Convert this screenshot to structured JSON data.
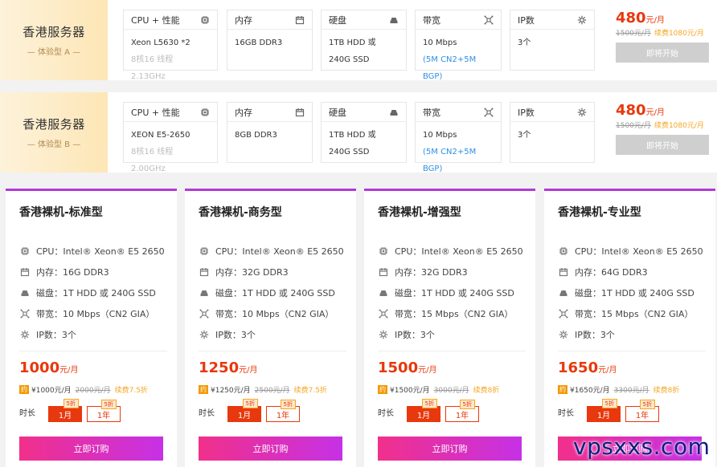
{
  "colors": {
    "price": "#e8380d",
    "accent_purple": "#b339d8",
    "renew": "#f5a623",
    "link_blue": "#2f8fe6",
    "disabled": "#cfcfcf"
  },
  "labels": {
    "cpu": "CPU + 性能",
    "mem": "内存",
    "disk": "硬盘",
    "bw": "带宽",
    "ip": "IP数"
  },
  "icons": {
    "cpu": "cpu-icon",
    "mem": "memory-icon",
    "disk": "disk-icon",
    "bw": "network-icon",
    "ip": "gear-icon"
  },
  "rows": [
    {
      "title": "香港服务器",
      "subtitle": "— 体验型 A —",
      "cpu": "Xeon L5630 *2",
      "cpu_sub": "8核16 线程 2.13GHz",
      "mem": "16GB DDR3",
      "disk1": "1TB HDD 或",
      "disk2": "240G SSD",
      "bw1": "10 Mbps",
      "bw2": "(5M CN2+5M BGP)",
      "ip": "3个",
      "price": "480",
      "unit": "元/月",
      "orig": "1500元/月",
      "renew": "续费1080元/月",
      "btn": "即将开始"
    },
    {
      "title": "香港服务器",
      "subtitle": "— 体验型 B —",
      "cpu": "XEON E5-2650",
      "cpu_sub": "8核16 线程 2.00GHz",
      "mem": "8GB DDR3",
      "disk1": "1TB HDD 或",
      "disk2": "240G SSD",
      "bw1": "10 Mbps",
      "bw2": "(5M CN2+5M BGP)",
      "ip": "3个",
      "price": "480",
      "unit": "元/月",
      "orig": "1500元/月",
      "renew": "续费1080元/月",
      "btn": "即将开始"
    }
  ],
  "cards": [
    {
      "title": "香港裸机-标准型",
      "cpu": "CPU：Intel® Xeon® E5 2650",
      "mem": "内存：16G DDR3",
      "disk": "磁盘：1T HDD 或 240G SSD",
      "bw": "带宽：10 Mbps（CN2 GIA）",
      "ip": "IP数：3个",
      "price": "1000",
      "unit": "元/月",
      "pay": "¥1000元/月",
      "orig": "2000元/月",
      "renew": "续费7.5折",
      "opt1": "1月",
      "opt1_disc": "5折",
      "opt2": "1年",
      "opt2_disc": "5折",
      "btn": "立即订购"
    },
    {
      "title": "香港裸机-商务型",
      "cpu": "CPU：Intel® Xeon® E5 2650",
      "mem": "内存：32G DDR3",
      "disk": "磁盘：1T HDD 或 240G SSD",
      "bw": "带宽：10 Mbps（CN2 GIA）",
      "ip": "IP数：3个",
      "price": "1250",
      "unit": "元/月",
      "pay": "¥1250元/月",
      "orig": "2500元/月",
      "renew": "续费7.5折",
      "opt1": "1月",
      "opt1_disc": "5折",
      "opt2": "1年",
      "opt2_disc": "5折",
      "btn": "立即订购"
    },
    {
      "title": "香港裸机-增强型",
      "cpu": "CPU：Intel® Xeon® E5 2650",
      "mem": "内存：32G DDR3",
      "disk": "磁盘：1T HDD 或 240G SSD",
      "bw": "带宽：15 Mbps（CN2 GIA）",
      "ip": "IP数：3个",
      "price": "1500",
      "unit": "元/月",
      "pay": "¥1500元/月",
      "orig": "3000元/月",
      "renew": "续费8折",
      "opt1": "1月",
      "opt1_disc": "5折",
      "opt2": "1年",
      "opt2_disc": "5折",
      "btn": "立即订购"
    },
    {
      "title": "香港裸机-专业型",
      "cpu": "CPU：Intel® Xeon® E5 2650",
      "mem": "内存：64G DDR3",
      "disk": "磁盘：1T HDD 或 240G SSD",
      "bw": "带宽：15 Mbps（CN2 GIA）",
      "ip": "IP数：3个",
      "price": "1650",
      "unit": "元/月",
      "pay": "¥1650元/月",
      "orig": "3300元/月",
      "renew": "续费8折",
      "opt1": "1月",
      "opt1_disc": "5折",
      "opt2": "1年",
      "opt2_disc": "5折",
      "btn": "立即订购"
    }
  ],
  "common": {
    "yue_badge": "约",
    "duration": "时长"
  },
  "watermark": "vpsxxs.com"
}
